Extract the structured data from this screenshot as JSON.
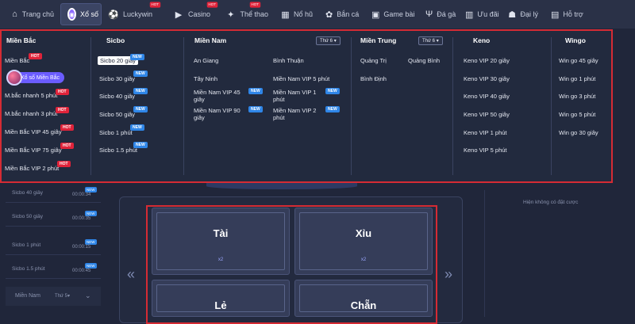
{
  "nav": {
    "items": [
      {
        "label": "Trang chủ",
        "icon": "home-icon"
      },
      {
        "label": "Xổ số",
        "icon": "lottery-icon",
        "active": true
      },
      {
        "label": "Luckywin",
        "icon": "soccer-ball-icon",
        "hot": "HOT"
      },
      {
        "label": "Casino",
        "icon": "play-icon",
        "hot": "HOT"
      },
      {
        "label": "Thể thao",
        "icon": "sports-icon",
        "hot": "HOT"
      },
      {
        "label": "Nổ hũ",
        "icon": "slot-icon"
      },
      {
        "label": "Bắn cá",
        "icon": "fish-icon"
      },
      {
        "label": "Game bài",
        "icon": "gamepad-icon"
      },
      {
        "label": "Đá gà",
        "icon": "rooster-icon"
      },
      {
        "label": "Ưu đãi",
        "icon": "gift-icon"
      },
      {
        "label": "Đại lý",
        "icon": "agent-icon"
      },
      {
        "label": "Hỗ trợ",
        "icon": "support-icon"
      }
    ]
  },
  "mega": {
    "mien_bac": {
      "title": "Miền Bắc",
      "items": [
        {
          "label": "Miền Bắc",
          "badge": "HOT"
        },
        {
          "label": "Xổ số Miền Bắc"
        },
        {
          "label": "M.bắc nhanh 5 phút",
          "badge": "HOT"
        },
        {
          "label": "M.bắc nhanh 3 phút",
          "badge": "HOT"
        },
        {
          "label": "Miền Bắc VIP 45 giây",
          "badge": "HOT"
        },
        {
          "label": "Miền Bắc VIP 75 giây",
          "badge": "HOT"
        },
        {
          "label": "Miền Bắc VIP 2 phút",
          "badge": "HOT"
        }
      ]
    },
    "sicbo": {
      "title": "Sicbo",
      "items": [
        {
          "label": "Sicbo 20 giây",
          "badge": "NEW"
        },
        {
          "label": "Sicbo 30 giây",
          "badge": "NEW"
        },
        {
          "label": "Sicbo 40 giây",
          "badge": "NEW"
        },
        {
          "label": "Sicbo 50 giây",
          "badge": "NEW"
        },
        {
          "label": "Sicbo 1 phút",
          "badge": "NEW"
        },
        {
          "label": "Sicbo 1.5 phút",
          "badge": "NEW"
        }
      ]
    },
    "mien_nam": {
      "title": "Miền Nam",
      "select": "Thứ 6",
      "left": [
        "An Giang",
        "Tây Ninh",
        "Miền Nam VIP 45 giây",
        "Miền Nam VIP 90 giây"
      ],
      "right": [
        "Bình Thuận",
        "Miền Nam VIP 5 phút",
        "Miền Nam VIP 1 phút",
        "Miền Nam VIP 2 phút"
      ],
      "new_badge": "NEW"
    },
    "mien_trung": {
      "title": "Miền Trung",
      "select": "Thứ 6",
      "items": [
        "Quảng Trị",
        "Quảng Bình",
        "Bình Định"
      ]
    },
    "keno": {
      "title": "Keno",
      "items": [
        "Keno VIP 20 giây",
        "Keno VIP 30 giây",
        "Keno VIP 40 giây",
        "Keno VIP 50 giây",
        "Keno VIP 1 phút",
        "Keno VIP 5 phút"
      ]
    },
    "wingo": {
      "title": "Wingo",
      "items": [
        "Win go 45 giây",
        "Win go 1 phút",
        "Win go 3 phút",
        "Win go 5 phút",
        "Win go 30 giây"
      ]
    }
  },
  "left_list": {
    "rows": [
      {
        "name": "Sicbo 40 giây",
        "time": "00:00:34",
        "badge": "NEW"
      },
      {
        "name": "Sicbo 50 giây",
        "time": "00:00:35",
        "badge": "NEW"
      },
      {
        "name": "Sicbo 1 phút",
        "time": "00:00:15",
        "badge": "NEW"
      },
      {
        "name": "Sicbo 1.5 phút",
        "time": "00:00:45",
        "badge": "NEW"
      }
    ],
    "filter_label": "Miền Nam",
    "filter_select": "Thứ 5"
  },
  "board": {
    "tiles": [
      {
        "label": "Tài",
        "odds": "x2"
      },
      {
        "label": "Xỉu",
        "odds": "x2"
      },
      {
        "label": "Lẻ",
        "odds": ""
      },
      {
        "label": "Chẵn",
        "odds": ""
      }
    ]
  },
  "right_panel": {
    "empty_text": "Hiện không có đặt cược"
  },
  "colors": {
    "accent_red": "#d52b34",
    "hot": "#e0233a",
    "new": "#2f86e8",
    "pill": "#6b5cff",
    "background": "#20263a"
  }
}
